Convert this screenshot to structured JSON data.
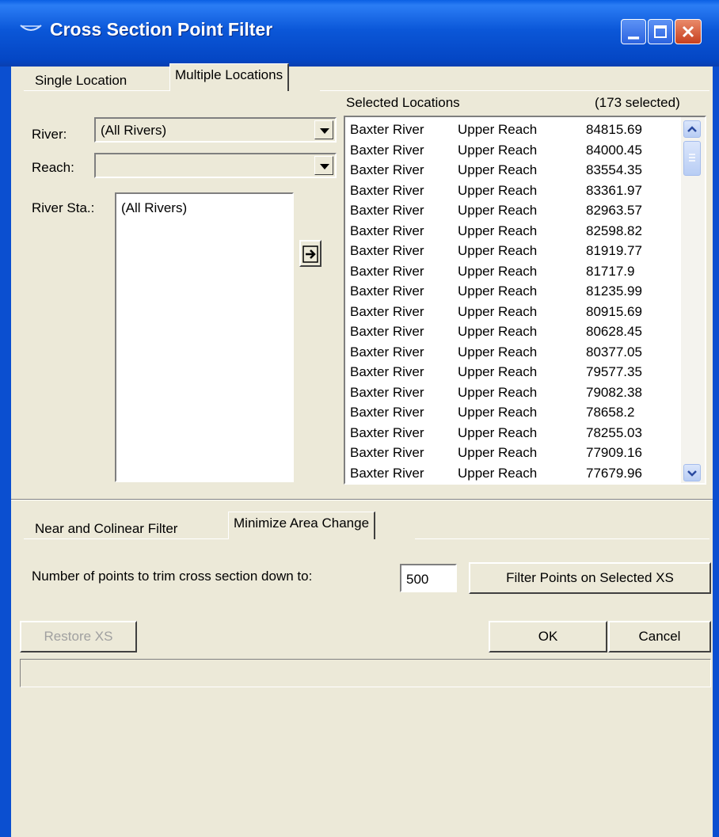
{
  "window": {
    "title": "Cross Section Point Filter",
    "icon": "river-xs-icon"
  },
  "top_tabs": [
    "Single Location",
    "Multiple Locations"
  ],
  "labels": {
    "river": "River:",
    "reach": "Reach:",
    "river_sta": "River Sta.:"
  },
  "river_combo": {
    "value": "(All Rivers)"
  },
  "reach_combo": {
    "value": ""
  },
  "river_sta_list": [
    "(All Rivers)"
  ],
  "add_button_icon": "arrow-right-icon",
  "selected": {
    "header": "Selected Locations",
    "count_text": "(173 selected)",
    "rows": [
      [
        "Baxter River",
        "Upper Reach",
        "84815.69"
      ],
      [
        "Baxter River",
        "Upper Reach",
        "84000.45"
      ],
      [
        "Baxter River",
        "Upper Reach",
        "83554.35"
      ],
      [
        "Baxter River",
        "Upper Reach",
        "83361.97"
      ],
      [
        "Baxter River",
        "Upper Reach",
        "82963.57"
      ],
      [
        "Baxter River",
        "Upper Reach",
        "82598.82"
      ],
      [
        "Baxter River",
        "Upper Reach",
        "81919.77"
      ],
      [
        "Baxter River",
        "Upper Reach",
        "81717.9"
      ],
      [
        "Baxter River",
        "Upper Reach",
        "81235.99"
      ],
      [
        "Baxter River",
        "Upper Reach",
        "80915.69"
      ],
      [
        "Baxter River",
        "Upper Reach",
        "80628.45"
      ],
      [
        "Baxter River",
        "Upper Reach",
        "80377.05"
      ],
      [
        "Baxter River",
        "Upper Reach",
        "79577.35"
      ],
      [
        "Baxter River",
        "Upper Reach",
        "79082.38"
      ],
      [
        "Baxter River",
        "Upper Reach",
        "78658.2"
      ],
      [
        "Baxter River",
        "Upper Reach",
        "78255.03"
      ],
      [
        "Baxter River",
        "Upper Reach",
        "77909.16"
      ],
      [
        "Baxter River",
        "Upper Reach",
        "77679.96"
      ]
    ]
  },
  "bottom_tabs": [
    "Near and Colinear Filter",
    "Minimize Area Change"
  ],
  "trim": {
    "label": "Number of points to trim cross section down to:",
    "value": "500"
  },
  "filter_button": "Filter Points on Selected XS",
  "restore_button": "Restore XS",
  "ok_button": "OK",
  "cancel_button": "Cancel",
  "status_text": ""
}
